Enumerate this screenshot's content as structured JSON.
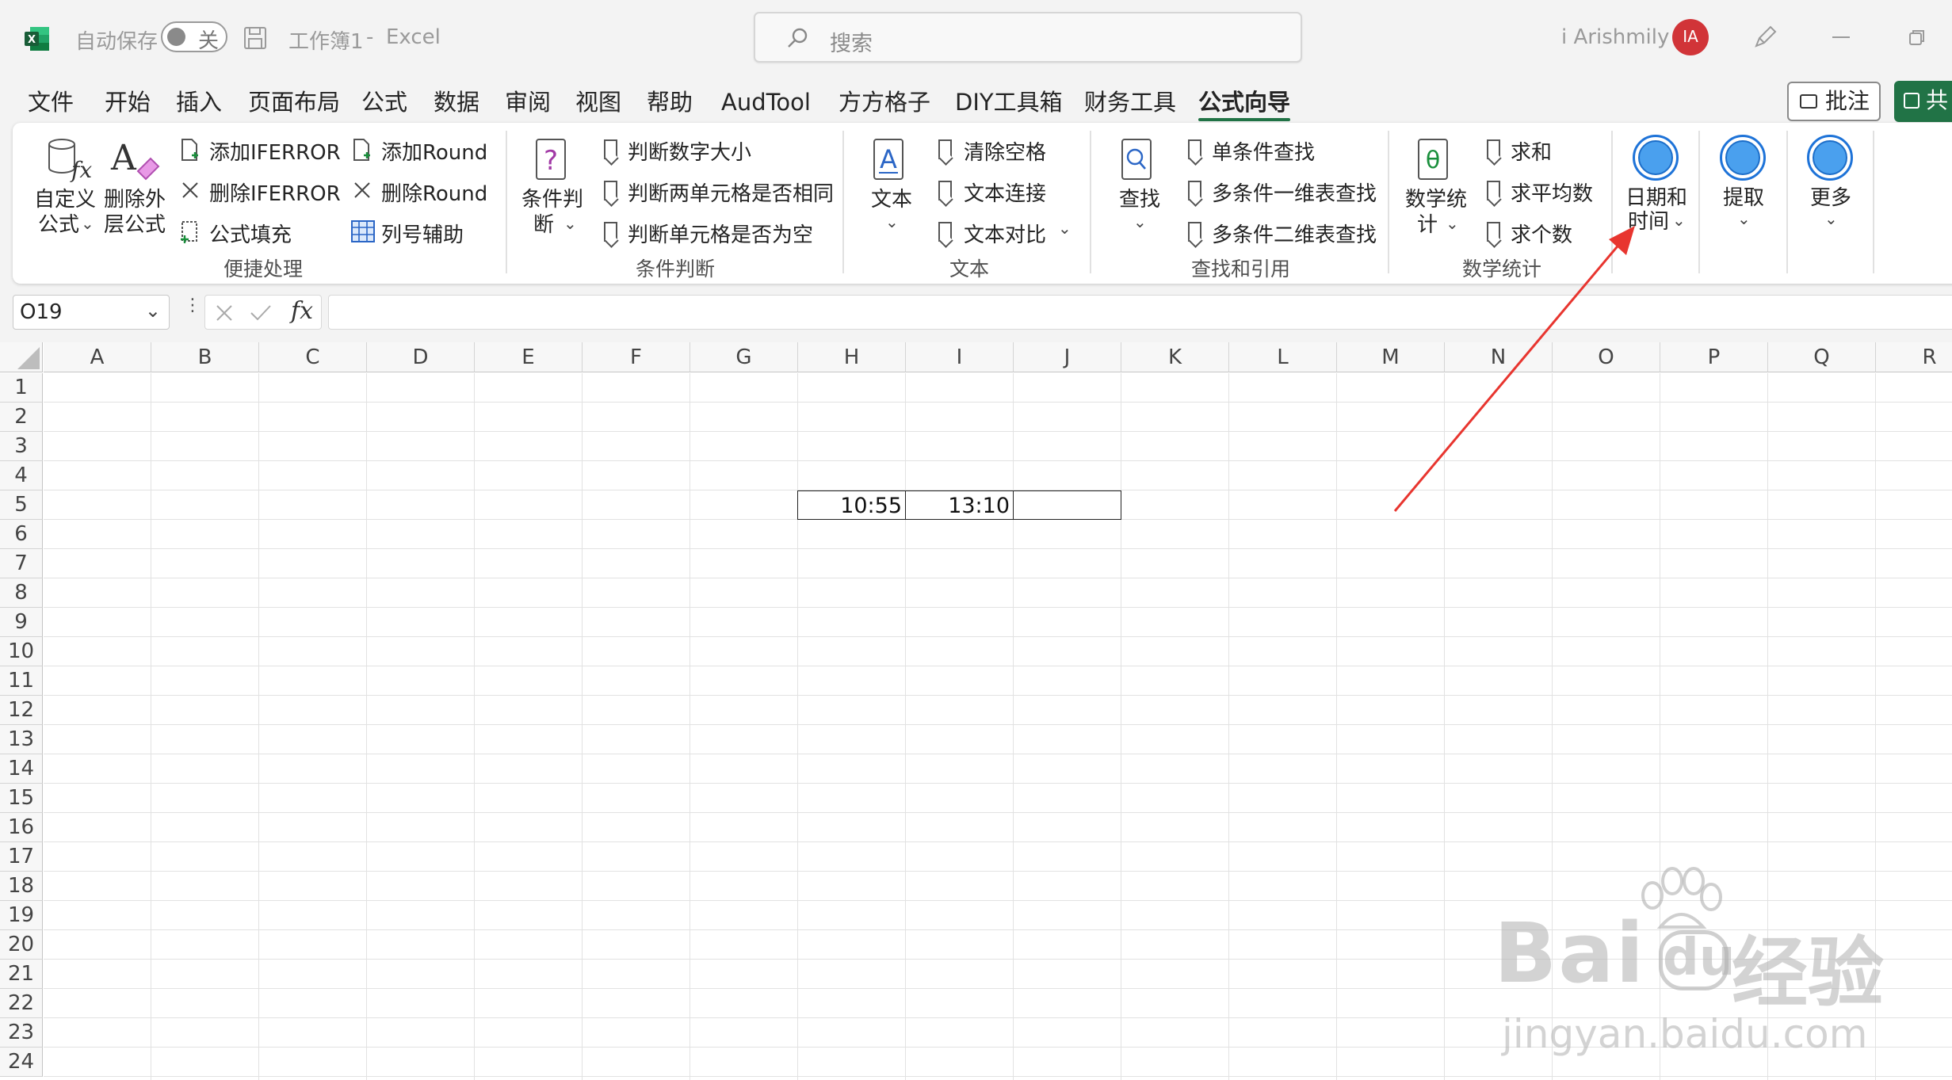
{
  "titlebar": {
    "autosave_label": "自动保存",
    "autosave_state": "关",
    "workbook": "工作簿1",
    "separator": "-",
    "app_name": "Excel",
    "search_placeholder": "搜索",
    "user_name": "i Arishmily",
    "user_initials": "IA"
  },
  "menu": {
    "tabs": [
      "文件",
      "开始",
      "插入",
      "页面布局",
      "公式",
      "数据",
      "审阅",
      "视图",
      "帮助",
      "AudTool",
      "方方格子",
      "DIY工具箱",
      "财务工具",
      "公式向导"
    ],
    "active_tab": "公式向导",
    "comment_button": "批注",
    "share_button": "共"
  },
  "ribbon": {
    "quick": {
      "custom_formula": "自定义公式",
      "custom_formula_l1": "自定义",
      "custom_formula_l2": "公式",
      "delete_outer_l1": "删除外",
      "delete_outer_l2": "层公式",
      "add_iferror": "添加IFERROR",
      "delete_iferror": "删除IFERROR",
      "formula_fill": "公式填充",
      "add_round": "添加Round",
      "delete_round": "删除Round",
      "col_helper": "列号辅助",
      "group_label": "便捷处理"
    },
    "condition": {
      "big_l1": "条件判",
      "big_l2": "断",
      "items": [
        "判断数字大小",
        "判断两单元格是否相同",
        "判断单元格是否为空"
      ],
      "group_label": "条件判断"
    },
    "text": {
      "big": "文本",
      "items": [
        "清除空格",
        "文本连接",
        "文本对比"
      ],
      "group_label": "文本"
    },
    "lookup": {
      "big": "查找",
      "items": [
        "单条件查找",
        "多条件一维表查找",
        "多条件二维表查找"
      ],
      "group_label": "查找和引用"
    },
    "stats": {
      "big_l1": "数学统",
      "big_l2": "计",
      "items": [
        "求和",
        "求平均数",
        "求个数"
      ],
      "group_label": "数学统计"
    },
    "datetime": {
      "l1": "日期和",
      "l2": "时间"
    },
    "extract": {
      "label": "提取"
    },
    "more": {
      "label": "更多"
    }
  },
  "formula_bar": {
    "name_box": "O19",
    "fx": "fx",
    "content": ""
  },
  "grid": {
    "columns": [
      "A",
      "B",
      "C",
      "D",
      "E",
      "F",
      "G",
      "H",
      "I",
      "J",
      "K",
      "L",
      "M",
      "N",
      "O",
      "P",
      "Q",
      "R"
    ],
    "rows": [
      "1",
      "2",
      "3",
      "4",
      "5",
      "6",
      "7",
      "8",
      "9",
      "10",
      "11",
      "12",
      "13",
      "14",
      "15",
      "16",
      "17",
      "18",
      "19",
      "20",
      "21",
      "22",
      "23",
      "24"
    ],
    "cells": {
      "H5": "10:55",
      "I5": "13:10",
      "J5": ""
    }
  },
  "annotation": {
    "arrow_color": "#e8352f"
  },
  "watermark": {
    "brand": "Bai",
    "brand_suffix": "经验",
    "url": "jingyan.baidu.com"
  }
}
